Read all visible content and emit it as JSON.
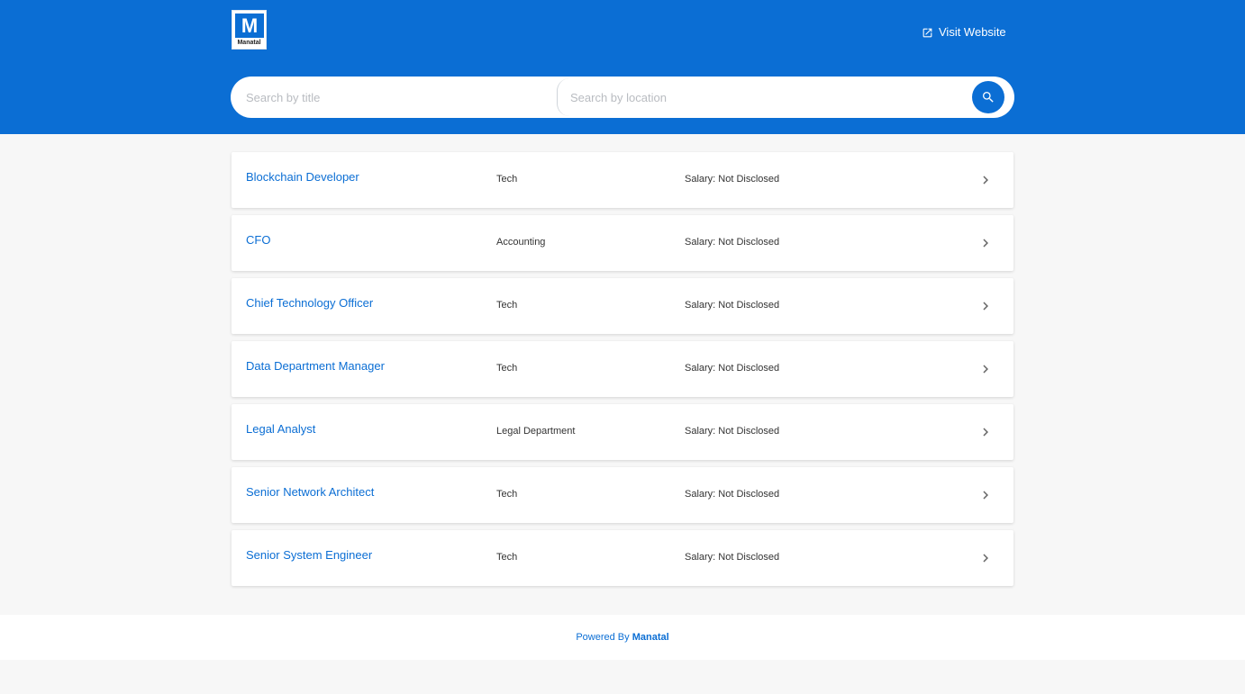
{
  "header": {
    "logo_letter": "M",
    "logo_word": "Manatal",
    "visit_label": "Visit Website",
    "accent_color": "#0b6ed4"
  },
  "search": {
    "title_placeholder": "Search by title",
    "location_placeholder": "Search by location",
    "button_icon": "search-icon"
  },
  "jobs": [
    {
      "title": "Blockchain Developer",
      "department": "Tech",
      "salary": "Salary: Not Disclosed"
    },
    {
      "title": "CFO",
      "department": "Accounting",
      "salary": "Salary: Not Disclosed"
    },
    {
      "title": "Chief Technology Officer",
      "department": "Tech",
      "salary": "Salary: Not Disclosed"
    },
    {
      "title": "Data Department Manager",
      "department": "Tech",
      "salary": "Salary: Not Disclosed"
    },
    {
      "title": "Legal Analyst",
      "department": "Legal Department",
      "salary": "Salary: Not Disclosed"
    },
    {
      "title": "Senior Network Architect",
      "department": "Tech",
      "salary": "Salary: Not Disclosed"
    },
    {
      "title": "Senior System Engineer",
      "department": "Tech",
      "salary": "Salary: Not Disclosed"
    }
  ],
  "footer": {
    "prefix": "Powered By",
    "brand": "Manatal"
  }
}
